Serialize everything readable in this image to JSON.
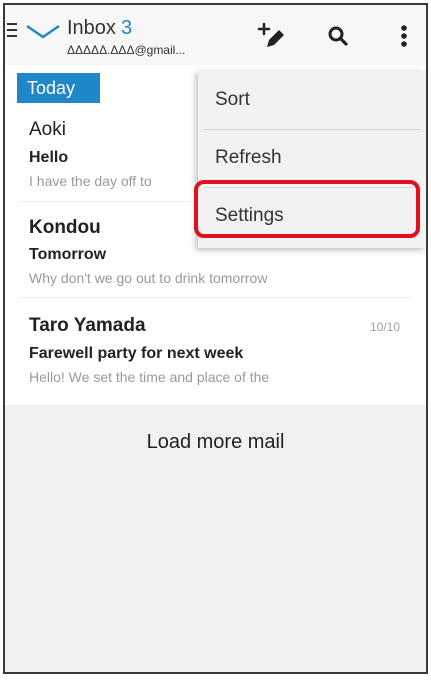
{
  "header": {
    "title": "Inbox",
    "unread_count": "3",
    "account": "ΔΔΔΔΔ.ΔΔΔ@gmail..."
  },
  "icons": {
    "drawer": "hamburger-menu-icon",
    "app": "envelope-icon",
    "compose": "compose-icon",
    "search": "search-icon",
    "overflow": "overflow-menu-icon"
  },
  "section_label": "Today",
  "mails": [
    {
      "sender": "Aoki",
      "subject": "Hello",
      "preview": "I have the day off to",
      "date": ""
    },
    {
      "sender": "Kondou",
      "subject": "Tomorrow",
      "preview": "Why don't we go out to drink tomorrow",
      "date": ""
    },
    {
      "sender": "Taro Yamada",
      "subject": "Farewell party for next week",
      "preview": "Hello! We set the time and place of the",
      "date": "10/10"
    }
  ],
  "load_more": "Load more mail",
  "menu": {
    "items": [
      "Sort",
      "Refresh",
      "Settings"
    ],
    "highlighted": "Settings"
  },
  "colors": {
    "accent": "#1f86c8",
    "highlight_border": "#e0101e"
  }
}
